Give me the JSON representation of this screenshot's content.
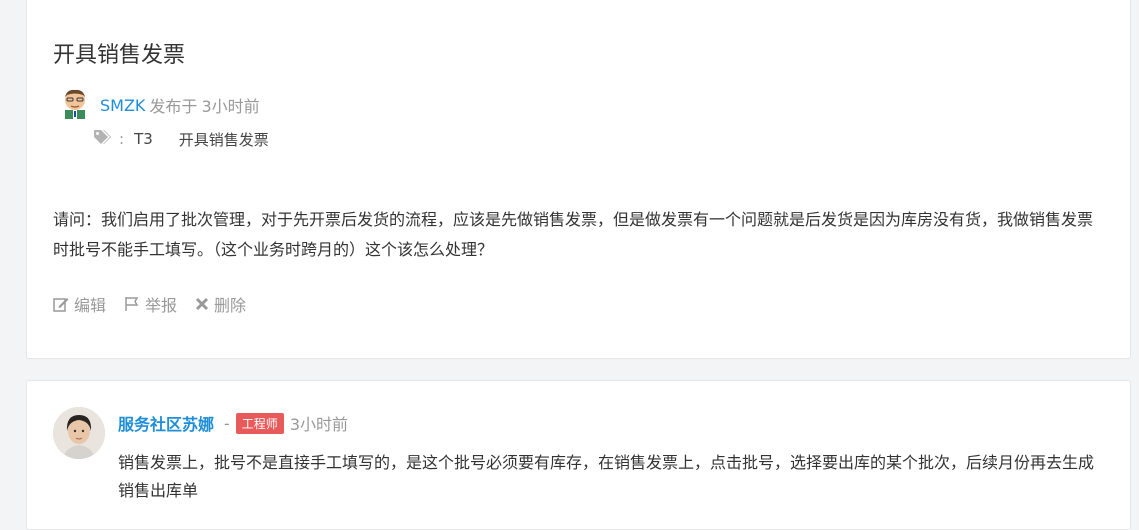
{
  "question": {
    "title": "开具销售发票",
    "author": "SMZK",
    "posted_label": "发布于",
    "posted_time": "3小时前",
    "tag_colon": ":",
    "tags": [
      "T3",
      "开具销售发票"
    ],
    "body": "请问：我们启用了批次管理，对于先开票后发货的流程，应该是先做销售发票，但是做发票有一个问题就是后发货是因为库房没有货，我做销售发票时批号不能手工填写。（这个业务时跨月的）这个该怎么处理？",
    "actions": {
      "edit": "编辑",
      "report": "举报",
      "delete": "删除"
    }
  },
  "answer": {
    "author": "服务社区苏娜",
    "separator": "-",
    "badge": "工程师",
    "time": "3小时前",
    "body": "销售发票上，批号不是直接手工填写的，是这个批号必须要有库存，在销售发票上，点击批号，选择要出库的某个批次，后续月份再去生成销售出库单"
  },
  "colors": {
    "link": "#1f8ed8",
    "muted": "#999999",
    "badge": "#e85a5a"
  }
}
